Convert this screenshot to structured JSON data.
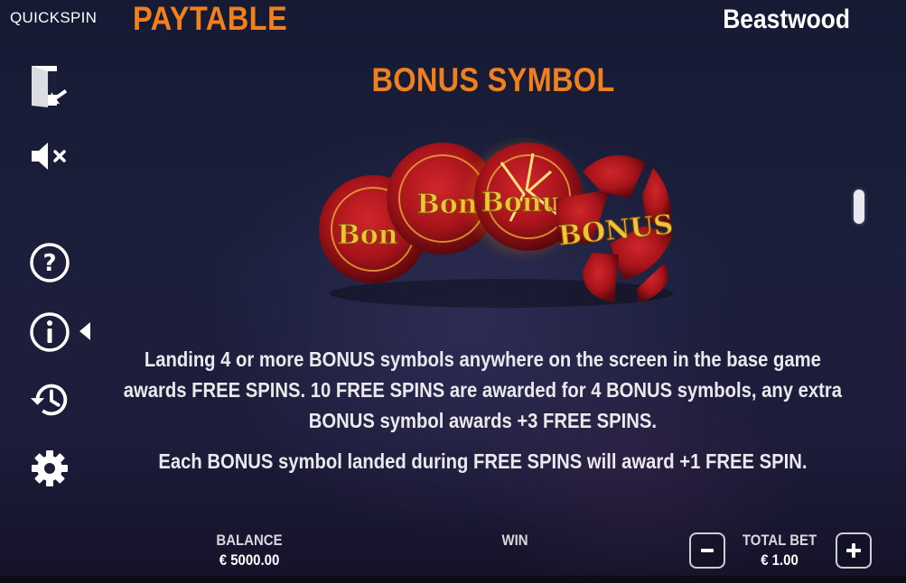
{
  "header": {
    "brand": "QUICKSPIN",
    "paytable_title": "PAYTABLE",
    "game_title": "Beastwood"
  },
  "sidebar": {
    "items": [
      {
        "name": "exit-icon"
      },
      {
        "name": "sound-muted-icon"
      },
      {
        "name": "help-icon"
      },
      {
        "name": "info-icon",
        "active": true
      },
      {
        "name": "history-icon"
      },
      {
        "name": "settings-gear-icon"
      }
    ]
  },
  "section": {
    "title": "BONUS SYMBOL",
    "symbol_text": "BONUS",
    "paragraph_1_line_1": "Landing 4 or more BONUS symbols anywhere on the screen in the base game",
    "paragraph_1_line_2": "awards FREE SPINS. 10 FREE SPINS are awarded for 4 BONUS symbols, any extra",
    "paragraph_1_line_3": "BONUS symbol awards +3 FREE SPINS.",
    "paragraph_2": "Each BONUS symbol landed during FREE SPINS will award +1 FREE SPIN."
  },
  "footer": {
    "balance_label": "BALANCE",
    "balance_value": "€ 5000.00",
    "win_label": "WIN",
    "total_bet_label": "TOTAL BET",
    "total_bet_value": "€ 1.00"
  },
  "colors": {
    "accent_orange": "#f07f1e",
    "seal_red": "#a8141a",
    "seal_gold": "#f2c23a",
    "background": "#1b1f3b"
  }
}
